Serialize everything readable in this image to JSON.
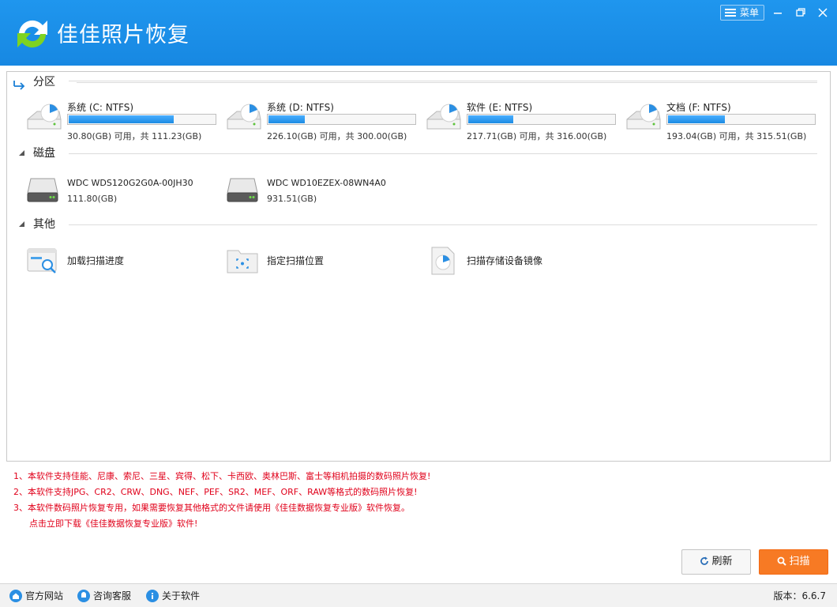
{
  "app": {
    "title": "佳佳照片恢复",
    "menu_label": "菜单"
  },
  "sections": {
    "partition": "分区",
    "disk": "磁盘",
    "other": "其他"
  },
  "partitions": [
    {
      "name": "系统 (C: NTFS)",
      "usage": "30.80(GB) 可用，共 111.23(GB)",
      "used_fraction": 0.72
    },
    {
      "name": "系统 (D: NTFS)",
      "usage": "226.10(GB) 可用，共 300.00(GB)",
      "used_fraction": 0.25
    },
    {
      "name": "软件 (E: NTFS)",
      "usage": "217.71(GB) 可用，共 316.00(GB)",
      "used_fraction": 0.31
    },
    {
      "name": "文档 (F: NTFS)",
      "usage": "193.04(GB) 可用，共 315.51(GB)",
      "used_fraction": 0.39
    }
  ],
  "disks": [
    {
      "name": "WDC WDS120G2G0A-00JH30",
      "size": "111.80(GB)"
    },
    {
      "name": "WDC WD10EZEX-08WN4A0",
      "size": "931.51(GB)"
    }
  ],
  "others": [
    {
      "label": "加载扫描进度",
      "icon": "load-progress-icon"
    },
    {
      "label": "指定扫描位置",
      "icon": "folder-target-icon"
    },
    {
      "label": "扫描存储设备镜像",
      "icon": "disk-image-icon"
    }
  ],
  "notes": [
    "1、本软件支持佳能、尼康、索尼、三星、宾得、松下、卡西欧、奥林巴斯、富士等相机拍摄的数码照片恢复!",
    "2、本软件支持JPG、CR2、CRW、DNG、NEF、PEF、SR2、MEF、ORF、RAW等格式的数码照片恢复!",
    "3、本软件数码照片恢复专用，如果需要恢复其他格式的文件请使用《佳佳数据恢复专业版》软件恢复。",
    "点击立即下载《佳佳数据恢复专业版》软件!"
  ],
  "buttons": {
    "refresh": "刷新",
    "scan": "扫描"
  },
  "footer": {
    "website": "官方网站",
    "support": "咨询客服",
    "about": "关于软件",
    "version": "版本：6.6.7"
  },
  "colors": {
    "titlebar": "#1a8fe8",
    "progress": "#1c8be3",
    "scan_button": "#f77a24",
    "notes_text": "#e0001a"
  }
}
